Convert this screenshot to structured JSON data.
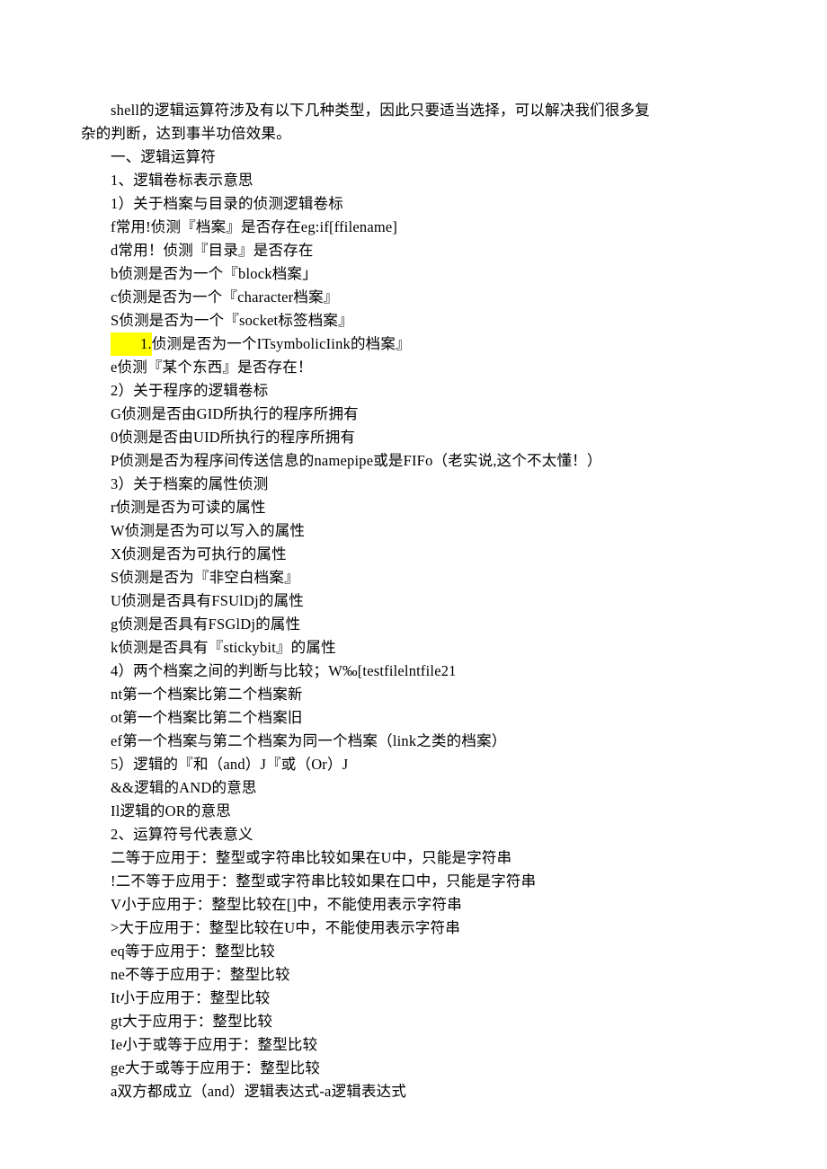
{
  "lines": [
    {
      "text": "shell的逻辑运算符涉及有以下几种类型，因此只要适当选择，可以解决我们很多复",
      "indent": true,
      "hl": false
    },
    {
      "text": "杂的判断，达到事半功倍效果。",
      "indent": false,
      "hl": false
    },
    {
      "text": "一、逻辑运算符",
      "indent": true,
      "hl": false
    },
    {
      "text": "1、逻辑卷标表示意思",
      "indent": true,
      "hl": false
    },
    {
      "text": "1）关于档案与目录的侦测逻辑卷标",
      "indent": true,
      "hl": false
    },
    {
      "text": "f常用!侦测『档案』是否存在eg:if[ffilename]",
      "indent": true,
      "hl": false
    },
    {
      "text": "d常用！侦测『目录』是否存在",
      "indent": true,
      "hl": false
    },
    {
      "text": "b侦测是否为一个『block档案」",
      "indent": true,
      "hl": false
    },
    {
      "text": "c侦测是否为一个『character档案』",
      "indent": true,
      "hl": false
    },
    {
      "text": "S侦测是否为一个『socket标签档案』",
      "indent": true,
      "hl": false
    },
    {
      "text": "1.侦测是否为一个ITsymbolicIink的档案』",
      "indent": true,
      "hl": "partial",
      "hlText": "1.",
      "rest": "侦测是否为一个ITsymbolicIink的档案』"
    },
    {
      "text": "e侦测『某个东西』是否存在！",
      "indent": true,
      "hl": false
    },
    {
      "text": "2）关于程序的逻辑卷标",
      "indent": true,
      "hl": false
    },
    {
      "text": "G侦测是否由GID所执行的程序所拥有",
      "indent": true,
      "hl": false
    },
    {
      "text": "0侦测是否由UID所执行的程序所拥有",
      "indent": true,
      "hl": false
    },
    {
      "text": "P侦测是否为程序间传送信息的namepipe或是FIFo（老实说,这个不太懂！）",
      "indent": true,
      "hl": false
    },
    {
      "text": "3）关于档案的属性侦测",
      "indent": true,
      "hl": false
    },
    {
      "text": "r侦测是否为可读的属性",
      "indent": true,
      "hl": false
    },
    {
      "text": "W侦测是否为可以写入的属性",
      "indent": true,
      "hl": false
    },
    {
      "text": "X侦测是否为可执行的属性",
      "indent": true,
      "hl": false
    },
    {
      "text": "S侦测是否为『非空白档案』",
      "indent": true,
      "hl": false
    },
    {
      "text": "U侦测是否具有FSUlDj的属性",
      "indent": true,
      "hl": false
    },
    {
      "text": "g侦测是否具有FSGlDj的属性",
      "indent": true,
      "hl": false
    },
    {
      "text": "k侦测是否具有『stickybit』的属性",
      "indent": true,
      "hl": false
    },
    {
      "text": "4）两个档案之间的判断与比较；W‰[testfilelntfile21",
      "indent": true,
      "hl": false
    },
    {
      "text": "nt第一个档案比第二个档案新",
      "indent": true,
      "hl": false
    },
    {
      "text": "ot第一个档案比第二个档案旧",
      "indent": true,
      "hl": false
    },
    {
      "text": "ef第一个档案与第二个档案为同一个档案（link之类的档案）",
      "indent": true,
      "hl": false
    },
    {
      "text": "5）逻辑的『和（and）J『或（Or）J",
      "indent": true,
      "hl": false
    },
    {
      "text": "&&逻辑的AND的意思",
      "indent": true,
      "hl": false
    },
    {
      "text": "Il逻辑的OR的意思",
      "indent": true,
      "hl": false
    },
    {
      "text": "2、运算符号代表意义",
      "indent": true,
      "hl": false
    },
    {
      "text": "二等于应用于：整型或字符串比较如果在U中，只能是字符串",
      "indent": true,
      "hl": false
    },
    {
      "text": "!二不等于应用于：整型或字符串比较如果在口中，只能是字符串",
      "indent": true,
      "hl": false
    },
    {
      "text": "V小于应用于：整型比较在[]中，不能使用表示字符串",
      "indent": true,
      "hl": false
    },
    {
      "text": ">大于应用于：整型比较在U中，不能使用表示字符串",
      "indent": true,
      "hl": false
    },
    {
      "text": "eq等于应用于：整型比较",
      "indent": true,
      "hl": false
    },
    {
      "text": "ne不等于应用于：整型比较",
      "indent": true,
      "hl": false
    },
    {
      "text": "It小于应用于：整型比较",
      "indent": true,
      "hl": false
    },
    {
      "text": "gt大于应用于：整型比较",
      "indent": true,
      "hl": false
    },
    {
      "text": "Ie小于或等于应用于：整型比较",
      "indent": true,
      "hl": false
    },
    {
      "text": "ge大于或等于应用于：整型比较",
      "indent": true,
      "hl": false
    },
    {
      "text": "a双方都成立（and）逻辑表达式-a逻辑表达式",
      "indent": true,
      "hl": false
    }
  ]
}
